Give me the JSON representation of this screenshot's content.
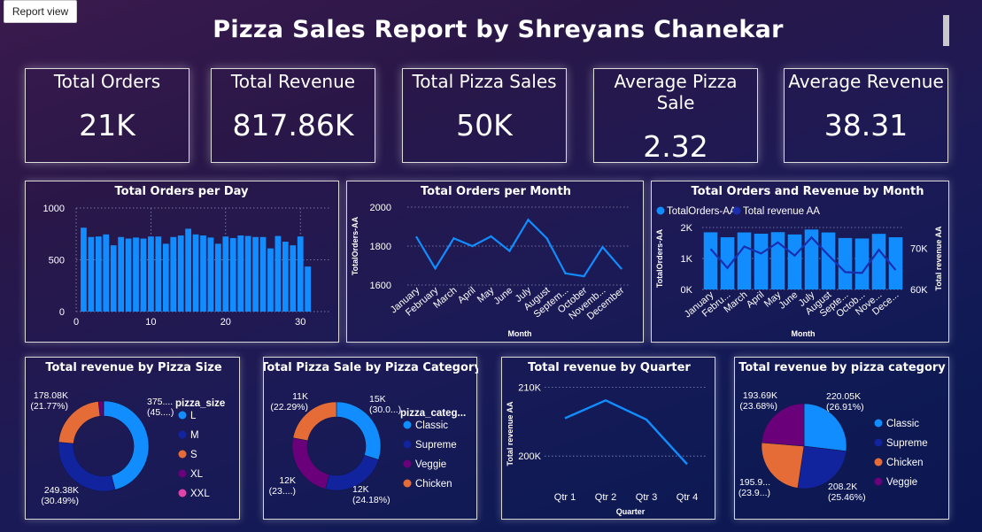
{
  "tab": {
    "label": "Report view"
  },
  "title": "Pizza Sales Report by Shreyans Chanekar",
  "kpis": [
    {
      "label": "Total Orders",
      "value": "21K"
    },
    {
      "label": "Total Revenue",
      "value": "817.86K"
    },
    {
      "label": "Total Pizza Sales",
      "value": "50K"
    },
    {
      "label": "Average Pizza Sale",
      "value": "2.32"
    },
    {
      "label": "Average Revenue",
      "value": "38.31"
    }
  ],
  "colors": {
    "blue": "#118dff",
    "navy": "#12239e",
    "orange": "#e66c37",
    "purple": "#6b007b",
    "pink": "#e044a7",
    "line": "#118dff",
    "revLine": "#1a2fb0"
  },
  "chart_data": [
    {
      "id": "orders_per_day",
      "type": "bar",
      "title": "Total Orders per Day",
      "x": [
        1,
        2,
        3,
        4,
        5,
        6,
        7,
        8,
        9,
        10,
        11,
        12,
        13,
        14,
        15,
        16,
        17,
        18,
        19,
        20,
        21,
        22,
        23,
        24,
        25,
        26,
        27,
        28,
        29,
        30,
        31
      ],
      "values": [
        810,
        720,
        725,
        745,
        640,
        720,
        705,
        715,
        705,
        725,
        725,
        655,
        720,
        735,
        800,
        745,
        735,
        715,
        655,
        725,
        710,
        735,
        730,
        720,
        720,
        610,
        730,
        675,
        640,
        725,
        435
      ],
      "ylim": [
        0,
        1000
      ],
      "yticks": [
        0,
        500,
        1000
      ],
      "xticks": [
        0,
        10,
        20,
        30
      ],
      "xlabel": "",
      "ylabel": "",
      "grid": true
    },
    {
      "id": "orders_per_month",
      "type": "line",
      "title": "Total Orders per Month",
      "categories": [
        "January",
        "February",
        "March",
        "April",
        "May",
        "June",
        "July",
        "August",
        "Septem...",
        "October",
        "Novemb...",
        "December"
      ],
      "values": [
        1845,
        1685,
        1840,
        1800,
        1850,
        1775,
        1935,
        1840,
        1660,
        1645,
        1795,
        1685
      ],
      "ylim": [
        1600,
        2000
      ],
      "yticks": [
        1600,
        1800,
        2000
      ],
      "xlabel": "Month",
      "ylabel": "TotalOrders-AA"
    },
    {
      "id": "orders_revenue_month",
      "type": "bar",
      "title": "Total Orders and Revenue by Month",
      "categories": [
        "January",
        "Febru...",
        "March",
        "April",
        "May",
        "June",
        "July",
        "August",
        "Septe...",
        "Octob...",
        "Nove...",
        "Dece..."
      ],
      "series": [
        {
          "name": "TotalOrders-AA",
          "type": "bar",
          "values": [
            1845,
            1685,
            1840,
            1800,
            1850,
            1775,
            1935,
            1840,
            1660,
            1645,
            1795,
            1685
          ]
        },
        {
          "name": "Total revenue AA",
          "type": "line",
          "values": [
            69800,
            65200,
            70400,
            68700,
            71400,
            68200,
            72600,
            68300,
            64200,
            64000,
            69600,
            64700
          ]
        }
      ],
      "ylim": [
        0,
        2000
      ],
      "yticks": [
        "0K",
        "1K",
        "2K"
      ],
      "y2lim": [
        60000,
        75000
      ],
      "y2ticks": [
        "60K",
        "70K"
      ],
      "xlabel": "Month",
      "ylabel": "TotalOrders-AA",
      "y2label": "Total revenue AA",
      "legend": "top-left"
    },
    {
      "id": "revenue_by_size",
      "type": "pie",
      "title": "Total revenue by Pizza Size",
      "legend_title": "pizza_size",
      "categories": [
        "L",
        "M",
        "S",
        "XL",
        "XXL"
      ],
      "values": [
        375123,
        249380,
        178080,
        14076,
        1007
      ],
      "labels": [
        {
          "text": "375....",
          "pct": "(45....)"
        },
        {
          "text": "249.38K",
          "pct": "(30.49%)"
        },
        {
          "text": "178.08K",
          "pct": "(21.77%)"
        }
      ]
    },
    {
      "id": "sale_by_category",
      "type": "pie",
      "title": "Total Pizza Sale by Pizza Category",
      "legend_title": "pizza_categ...",
      "categories": [
        "Classic",
        "Supreme",
        "Veggie",
        "Chicken"
      ],
      "values": [
        15000,
        12000,
        12000,
        11000
      ],
      "labels": [
        {
          "text": "15K",
          "pct": "(30.0...)"
        },
        {
          "text": "12K",
          "pct": "(24.18%)"
        },
        {
          "text": "12K",
          "pct": "(23....)"
        },
        {
          "text": "11K",
          "pct": "(22.29%)"
        }
      ]
    },
    {
      "id": "revenue_by_quarter",
      "type": "line",
      "title": "Total revenue by Quarter",
      "categories": [
        "Qtr 1",
        "Qtr 2",
        "Qtr 3",
        "Qtr 4"
      ],
      "values": [
        205500,
        208100,
        205300,
        198800
      ],
      "ylim": [
        195000,
        212000
      ],
      "yticks": [
        "200K",
        "210K"
      ],
      "xlabel": "Quarter",
      "ylabel": "Total revenue AA"
    },
    {
      "id": "revenue_by_category",
      "type": "pie",
      "title": "Total revenue by pizza category",
      "categories": [
        "Classic",
        "Supreme",
        "Chicken",
        "Veggie"
      ],
      "values": [
        220050,
        208200,
        195900,
        193690
      ],
      "labels": [
        {
          "text": "220.05K",
          "pct": "(26.91%)"
        },
        {
          "text": "208.2K",
          "pct": "(25.46%)"
        },
        {
          "text": "195.9...",
          "pct": "(23.9...)"
        },
        {
          "text": "193.69K",
          "pct": "(23.68%)"
        }
      ]
    }
  ]
}
